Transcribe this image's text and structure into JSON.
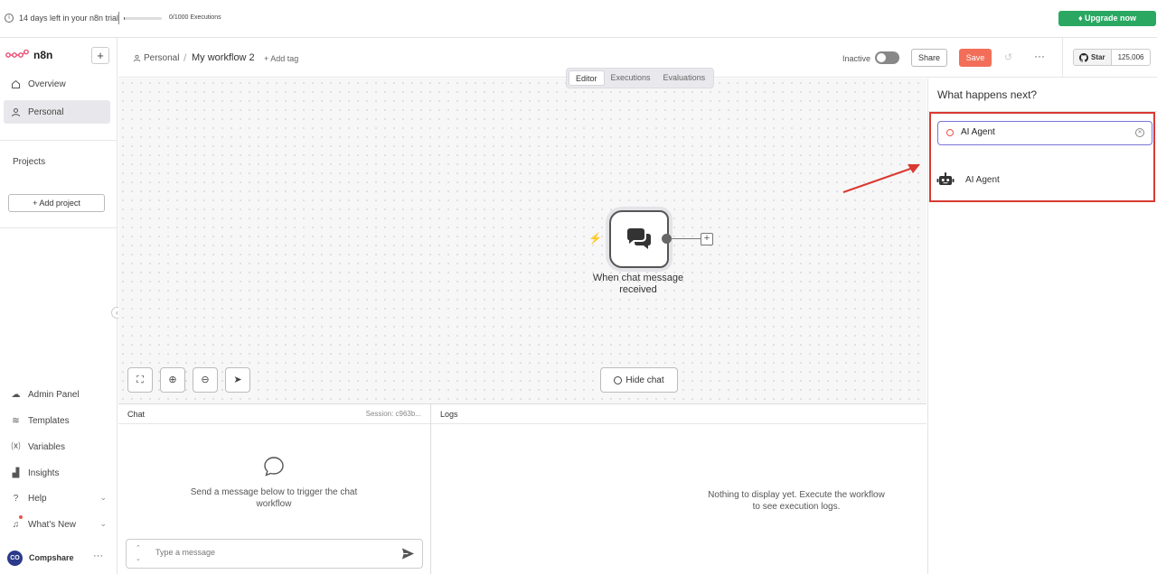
{
  "banner": {
    "trial_text": "14 days left in your n8n trial",
    "executions_text": "0/1000 Executions",
    "executions_fraction": 0.02,
    "upgrade_label": "Upgrade now"
  },
  "sidebar": {
    "logo_text": "n8n",
    "new_label": "+",
    "nav": [
      {
        "label": "Overview"
      },
      {
        "label": "Personal"
      }
    ],
    "projects_label": "Projects",
    "add_project_label": "+ Add project",
    "bottom": [
      {
        "label": "Admin Panel"
      },
      {
        "label": "Templates"
      },
      {
        "label": "Variables"
      },
      {
        "label": "Insights"
      },
      {
        "label": "Help"
      },
      {
        "label": "What's New"
      }
    ],
    "user": {
      "initials": "CO",
      "name": "Compshare",
      "more": "···"
    }
  },
  "header": {
    "breadcrumb_project": "Personal",
    "breadcrumb_sep": "/",
    "workflow_name": "My workflow 2",
    "add_tag": "+ Add tag",
    "inactive_label": "Inactive",
    "share_label": "Share",
    "save_label": "Save",
    "more_label": "···",
    "github": {
      "star_label": "Star",
      "count": "125,006"
    }
  },
  "canvas": {
    "tabs": [
      {
        "label": "Editor",
        "active": true
      },
      {
        "label": "Executions",
        "active": false
      },
      {
        "label": "Evaluations",
        "active": false
      }
    ],
    "node_label": "When chat message received",
    "hide_chat_label": "Hide chat"
  },
  "chat": {
    "title": "Chat",
    "session": "Session: c963b...",
    "empty_text": "Send a message below to trigger the chat workflow",
    "input_placeholder": "Type a message"
  },
  "logs": {
    "title": "Logs",
    "empty_text": "Nothing to display yet. Execute the workflow to see execution logs."
  },
  "node_panel": {
    "title": "What happens next?",
    "search_value": "AI Agent",
    "results": [
      {
        "label": "AI Agent",
        "icon": "robot-icon"
      }
    ]
  },
  "colors": {
    "accent": "#f26e58",
    "upgrade": "#2aa862",
    "highlight": "#d93a32",
    "search_border": "#7b73d6"
  }
}
